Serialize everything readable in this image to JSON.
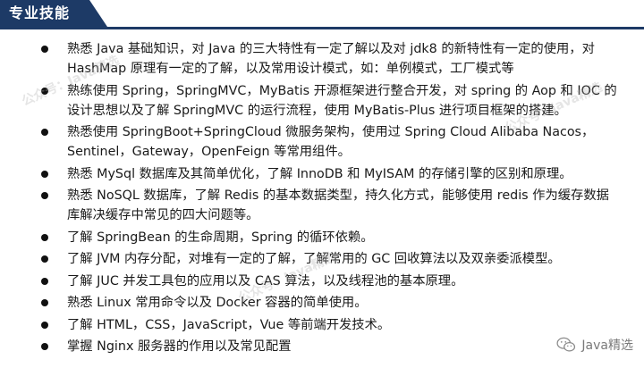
{
  "section": {
    "title": "专业技能"
  },
  "skills": [
    "熟悉 Java 基础知识，对 Java 的三大特性有一定了解以及对 jdk8 的新特性有一定的使用，对 HashMap 原理有一定的了解，以及常用设计模式，如：单例模式，工厂模式等",
    "熟练使用 Spring，SpringMVC，MyBatis 开源框架进行整合开发，对 spring 的 Aop 和 IOC 的设计思想以及了解 SpringMVC 的运行流程，使用 MyBatis-Plus 进行项目框架的搭建。",
    "熟悉使用 SpringBoot+SpringCloud 微服务架构，使用过 Spring Cloud Alibaba Nacos，Sentinel，Gateway，OpenFeign 等常用组件。",
    "熟悉 MySql 数据库及其简单优化，了解 InnoDB 和 MyISAM 的存储引擎的区别和原理。",
    "熟悉 NoSQL 数据库，了解 Redis 的基本数据类型，持久化方式，能够使用 redis 作为缓存数据库解决缓存中常见的四大问题等。",
    "了解 SpringBean 的生命周期，Spring 的循环依赖。",
    "了解 JVM 内存分配，对堆有一定的了解，了解常用的 GC 回收算法以及双亲委派模型。",
    "了解 JUC 并发工具包的应用以及 CAS 算法，以及线程池的基本原理。",
    "熟悉 Linux 常用命令以及 Docker 容器的简单使用。",
    "了解 HTML，CSS，JavaScript，Vue 等前端开发技术。",
    "掌握 Nginx 服务器的作用以及常见配置"
  ],
  "watermarks": [
    "公众号：Java精选",
    "公众号：Java精选",
    "公众号：Java精选"
  ],
  "brand": {
    "label": "Java精选",
    "icon": "wechat-icon"
  },
  "colors": {
    "header": "#1d3a66",
    "text": "#1a1a1a"
  }
}
